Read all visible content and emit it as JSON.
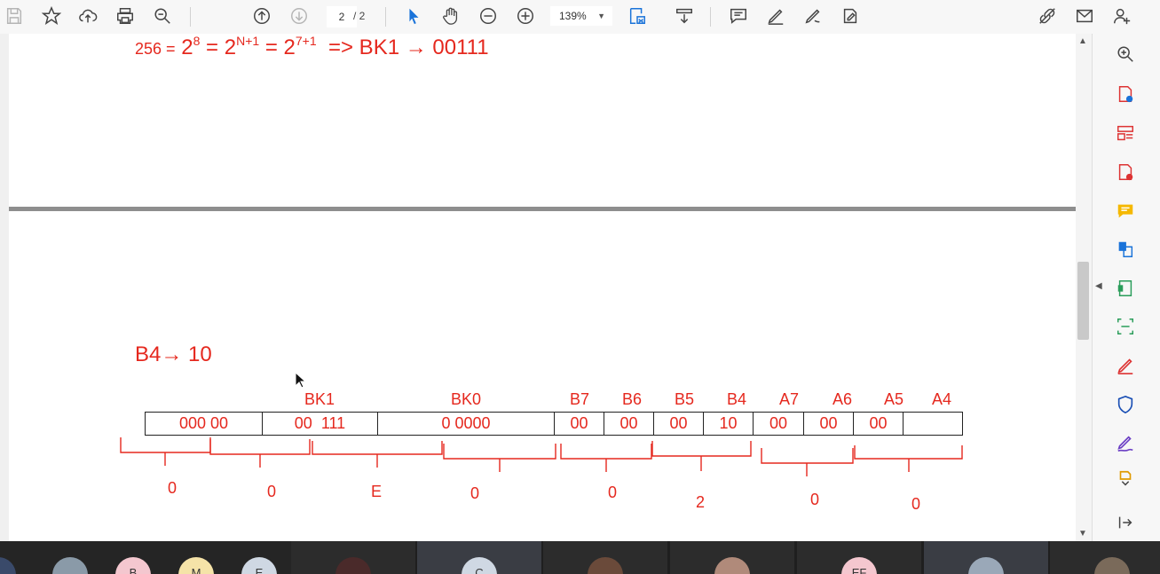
{
  "toolbar": {
    "page_current": "2",
    "page_total": "/ 2",
    "zoom": "139%",
    "icons": [
      "save-icon",
      "star-icon",
      "cloud-upload-icon",
      "print-icon",
      "search-zoom-icon",
      "page-up-icon",
      "page-down-icon",
      "select-cursor-icon",
      "hand-tool-icon",
      "zoom-out-icon",
      "zoom-in-icon",
      "fit-page-icon",
      "scroll-mode-icon",
      "comment-icon",
      "highlight-pen-icon",
      "sign-icon",
      "fill-sign-icon",
      "share-link-icon",
      "email-icon",
      "add-user-icon"
    ]
  },
  "document": {
    "formula": {
      "lhs": "256 =",
      "base1": "2",
      "exp1": "8",
      "eq1": "=",
      "base2": "2",
      "exp2": "N+1",
      "eq2": "=",
      "base3": "2",
      "exp3": "7+1",
      "result": "=> BK1 → 00111"
    },
    "b4_note": "B4→ 10",
    "register_headers": [
      "BK1",
      "BK0",
      "B7",
      "B6",
      "B5",
      "B4",
      "A7",
      "A6",
      "A5",
      "A4"
    ],
    "register_cells": [
      "000 00",
      "00  111",
      "0 0000",
      "00",
      "00",
      "00",
      "10",
      "00",
      "00",
      "00"
    ],
    "hex_digits": [
      "0",
      "0",
      "E",
      "0",
      "0",
      "2",
      "0",
      "0"
    ]
  },
  "right_panel_icons": [
    "zoom-icon",
    "export-pdf-icon",
    "organize-pages-icon",
    "create-pdf-icon",
    "comment-bubble-icon",
    "combine-files-icon",
    "edit-pdf-icon",
    "scan-ocr-icon",
    "fill-sign-icon",
    "protect-icon",
    "signature-icon",
    "more-tools-icon",
    "collapse-panel-icon"
  ],
  "participants": {
    "initials": [
      "B",
      "M",
      "E",
      "C",
      "EF"
    ]
  }
}
